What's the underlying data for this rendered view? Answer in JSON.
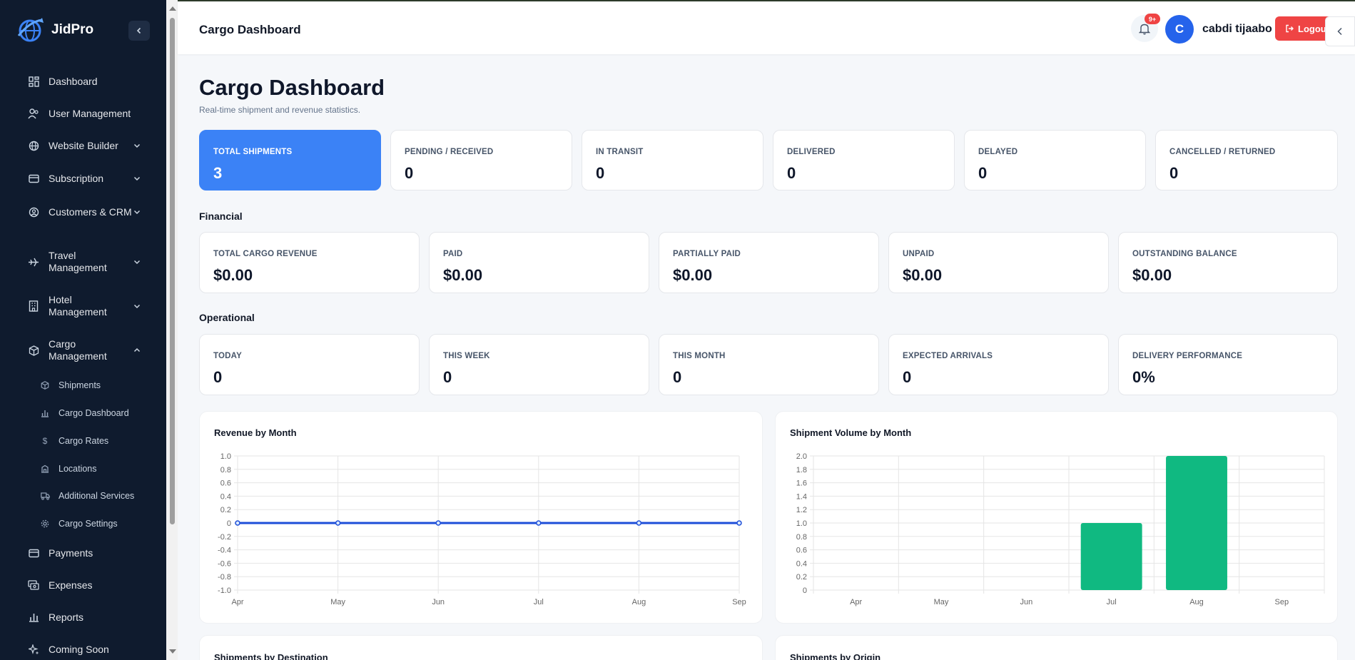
{
  "brand": {
    "name": "JidPro"
  },
  "sidebar": {
    "items": [
      {
        "label": "Dashboard",
        "icon": "grid-icon"
      },
      {
        "label": "User Management",
        "icon": "users-icon"
      },
      {
        "label": "Website Builder",
        "icon": "globe-icon"
      },
      {
        "label": "Subscription",
        "icon": "credit-card-icon"
      },
      {
        "label": "Customers & CRM",
        "icon": "user-circle-icon"
      },
      {
        "label": "Travel Management",
        "icon": "plane-icon"
      },
      {
        "label": "Hotel Management",
        "icon": "building-icon"
      },
      {
        "label": "Cargo Management",
        "icon": "box-icon"
      },
      {
        "label": "Payments",
        "icon": "wallet-icon"
      },
      {
        "label": "Expenses",
        "icon": "money-icon"
      },
      {
        "label": "Reports",
        "icon": "bar-chart-icon"
      },
      {
        "label": "Coming Soon",
        "icon": "sparkle-icon"
      }
    ],
    "cargo_sub": [
      {
        "label": "Shipments",
        "icon": "box-icon"
      },
      {
        "label": "Cargo Dashboard",
        "icon": "bar-chart-icon"
      },
      {
        "label": "Cargo Rates",
        "icon": "dollar-icon"
      },
      {
        "label": "Locations",
        "icon": "building-icon"
      },
      {
        "label": "Additional Services",
        "icon": "truck-icon"
      },
      {
        "label": "Cargo Settings",
        "icon": "gear-icon"
      }
    ]
  },
  "header": {
    "title": "Cargo Dashboard",
    "notifications_badge": "9+",
    "avatar_initial": "C",
    "username": "cabdi tijaabo",
    "logout_label": "Logout"
  },
  "page": {
    "title": "Cargo Dashboard",
    "subtitle": "Real-time shipment and revenue statistics."
  },
  "stats": [
    {
      "label": "TOTAL SHIPMENTS",
      "value": "3"
    },
    {
      "label": "PENDING / RECEIVED",
      "value": "0"
    },
    {
      "label": "IN TRANSIT",
      "value": "0"
    },
    {
      "label": "DELIVERED",
      "value": "0"
    },
    {
      "label": "DELAYED",
      "value": "0"
    },
    {
      "label": "CANCELLED / RETURNED",
      "value": "0"
    }
  ],
  "financial": {
    "title": "Financial",
    "cards": [
      {
        "label": "TOTAL CARGO REVENUE",
        "value": "$0.00"
      },
      {
        "label": "PAID",
        "value": "$0.00"
      },
      {
        "label": "PARTIALLY PAID",
        "value": "$0.00"
      },
      {
        "label": "UNPAID",
        "value": "$0.00"
      },
      {
        "label": "OUTSTANDING BALANCE",
        "value": "$0.00"
      }
    ]
  },
  "operational": {
    "title": "Operational",
    "cards": [
      {
        "label": "TODAY",
        "value": "0"
      },
      {
        "label": "THIS WEEK",
        "value": "0"
      },
      {
        "label": "THIS MONTH",
        "value": "0"
      },
      {
        "label": "EXPECTED ARRIVALS",
        "value": "0"
      },
      {
        "label": "DELIVERY PERFORMANCE",
        "value": "0%"
      }
    ]
  },
  "bottom_cards": {
    "destination_title": "Shipments by Destination",
    "origin_title": "Shipments by Origin"
  },
  "colors": {
    "sidebar": "#0f1b2e",
    "primary": "#3b82f6",
    "bar": "#10b981",
    "line": "#1d4ed8",
    "danger": "#ef4444"
  },
  "chart_data": [
    {
      "type": "line",
      "title": "Revenue by Month",
      "x": [
        "Apr",
        "May",
        "Jun",
        "Jul",
        "Aug",
        "Sep"
      ],
      "series": [
        {
          "values": [
            0,
            0,
            0,
            0,
            0,
            0
          ]
        }
      ],
      "ylim": [
        -1.0,
        1.0
      ],
      "yticks": [
        "1.0",
        "0.8",
        "0.6",
        "0.4",
        "0.2",
        "0",
        "-0.2",
        "-0.4",
        "-0.6",
        "-0.8",
        "-1.0"
      ],
      "grid": true
    },
    {
      "type": "bar",
      "title": "Shipment Volume by Month",
      "categories": [
        "Apr",
        "May",
        "Jun",
        "Jul",
        "Aug",
        "Sep"
      ],
      "values": [
        0,
        0,
        0,
        1,
        2,
        0
      ],
      "ylim": [
        0,
        2.0
      ],
      "yticks": [
        "2.0",
        "1.8",
        "1.6",
        "1.4",
        "1.2",
        "1.0",
        "0.8",
        "0.6",
        "0.4",
        "0.2",
        "0"
      ],
      "grid": true
    }
  ]
}
